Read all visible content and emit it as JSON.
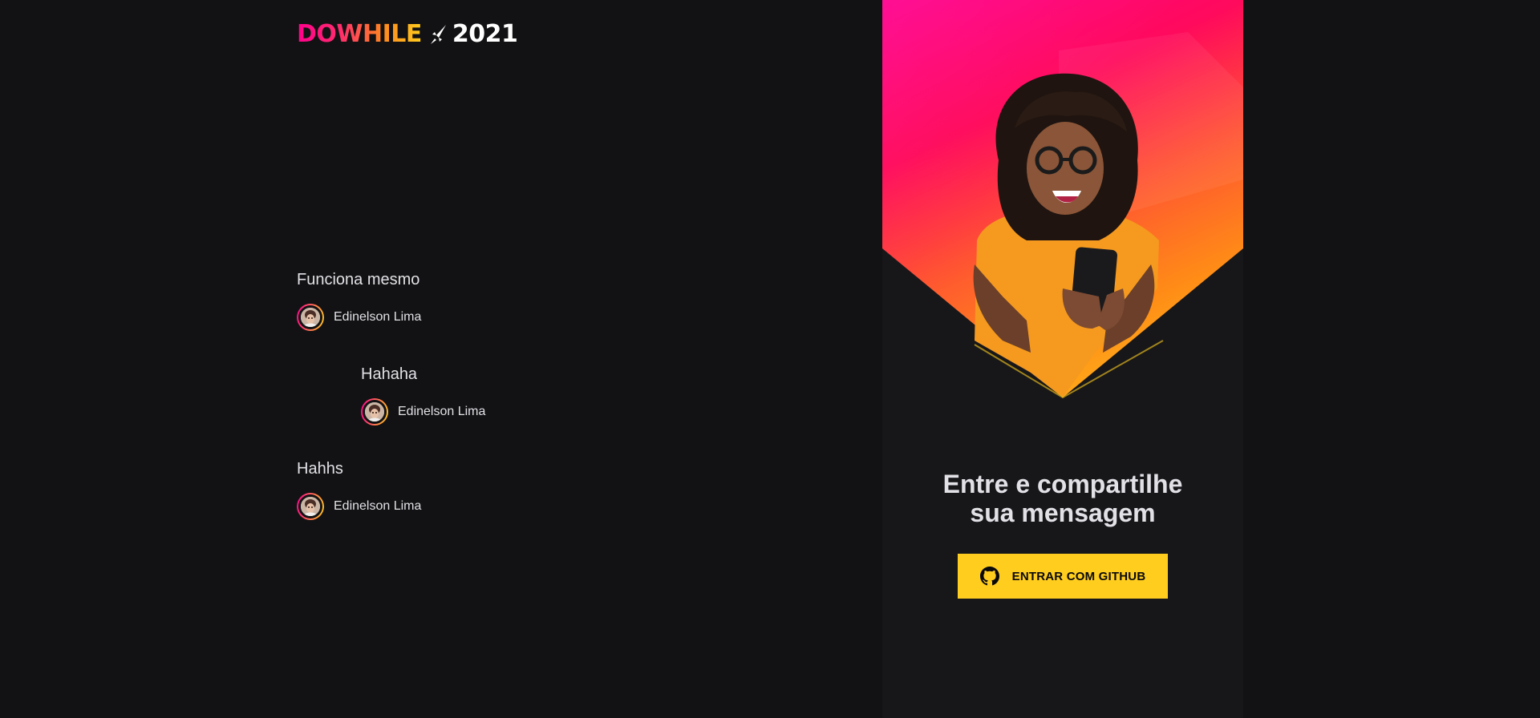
{
  "logo": {
    "dowhile_text": "DOWHILE",
    "year_text": "2021",
    "icon": "rocket-icon"
  },
  "messages": [
    {
      "text": "Funciona mesmo",
      "user": "Edinelson Lima",
      "avatar_icon": "avatar"
    },
    {
      "text": "Hahaha",
      "user": "Edinelson Lima",
      "avatar_icon": "avatar"
    },
    {
      "text": "Hahhs",
      "user": "Edinelson Lima",
      "avatar_icon": "avatar"
    }
  ],
  "banner": {
    "title_line1": "Entre e compartilhe",
    "title_line2": "sua mensagem",
    "github_button_label": "ENTRAR COM GITHUB",
    "github_icon": "github-icon"
  },
  "colors": {
    "background": "#121214",
    "banner_background": "#17171a",
    "accent_pink": "#ff008e",
    "accent_yellow": "#ffcd1e",
    "text": "#e1e1e6"
  }
}
